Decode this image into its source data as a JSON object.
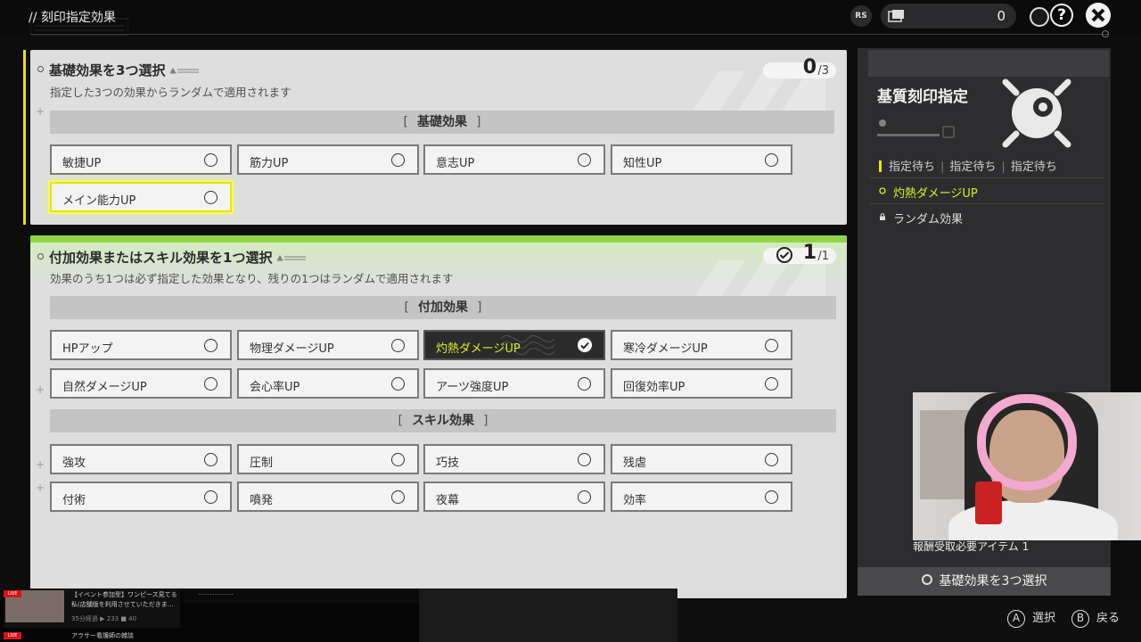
{
  "header": {
    "title": "// 刻印指定効果",
    "rs_label": "RS",
    "item_count": "0"
  },
  "base_section": {
    "title": "基礎効果を3つ選択",
    "subtitle": "指定した3つの効果からランダムで適用されます",
    "count": "0",
    "total": "/3",
    "category": "基礎効果",
    "options": [
      "敏捷UP",
      "筋力UP",
      "意志UP",
      "知性UP",
      "メイン能力UP"
    ]
  },
  "extra_section": {
    "title": "付加効果またはスキル効果を1つ選択",
    "subtitle": "効果のうち1つは必ず指定した効果となり、残りの1つはランダムで適用されます",
    "count": "1",
    "total": "/1",
    "category_additional": "付加効果",
    "additional_options": [
      "HPアップ",
      "物理ダメージUP",
      "灼熱ダメージUP",
      "寒冷ダメージUP",
      "自然ダメージUP",
      "会心率UP",
      "アーツ強度UP",
      "回復効率UP"
    ],
    "selected": "灼熱ダメージUP",
    "category_skill": "スキル効果",
    "skill_options": [
      "強攻",
      "圧制",
      "巧技",
      "残虐",
      "付術",
      "噴発",
      "夜幕",
      "効率"
    ]
  },
  "side_panel": {
    "title": "基質刻印指定",
    "slot_1": "指定待ち",
    "slot_2": "指定待ち",
    "slot_3": "指定待ち",
    "selected_effect": "灼熱ダメージUP",
    "random_effect": "ランダム効果",
    "reward_text": "報酬受取必要アイテム  1",
    "confirm_label": "基礎効果を3つ選択"
  },
  "footer": {
    "select_key": "A",
    "select_label": "選択",
    "back_key": "B",
    "back_label": "戻る"
  },
  "overlay": {
    "live_badge": "LIVE",
    "stream1_title": "【イベント参加型】ワンピース見てる",
    "stream1_sub": "私(店舗版を利用させていただきま…",
    "stream1_meta": "35分経過  ▶ 233  ■ 40",
    "stream2_title": "アラサー看護師の雑談",
    "middle_text": "……………"
  },
  "colors": {
    "accent_yellow": "#e6e600",
    "accent_green": "#92d449",
    "selected_text": "#d6ef2b"
  }
}
